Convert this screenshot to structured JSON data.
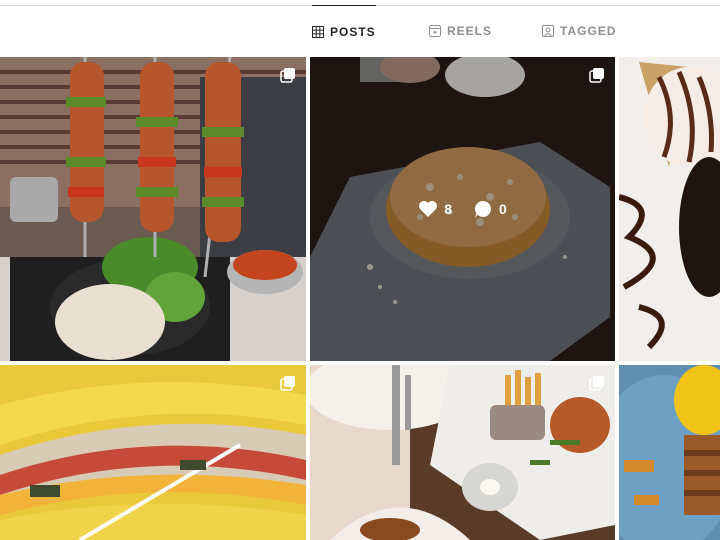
{
  "tabs": [
    {
      "label": "POSTS",
      "icon": "grid-icon",
      "active": true
    },
    {
      "label": "REELS",
      "icon": "reels-icon",
      "active": false
    },
    {
      "label": "TAGGED",
      "icon": "tagged-icon",
      "active": false
    }
  ],
  "grid": {
    "posts": [
      {
        "alt": "Grilled skewers with salad and rice",
        "multiple": true
      },
      {
        "alt": "Kunafa dessert on grey plate",
        "multiple": true,
        "hovered": true,
        "likes": "8",
        "comments": "0"
      },
      {
        "alt": "Ice cream with chocolate sauce",
        "multiple": false
      },
      {
        "alt": "Sandwich with yellow bread",
        "multiple": true
      },
      {
        "alt": "Restaurant table with fries and dishes",
        "multiple": true
      },
      {
        "alt": "Dessert plate with cake",
        "multiple": false
      }
    ]
  },
  "colors": {
    "active_tab": "#262626",
    "inactive_tab": "#8e8e8e",
    "divider": "#dbdbdb"
  }
}
